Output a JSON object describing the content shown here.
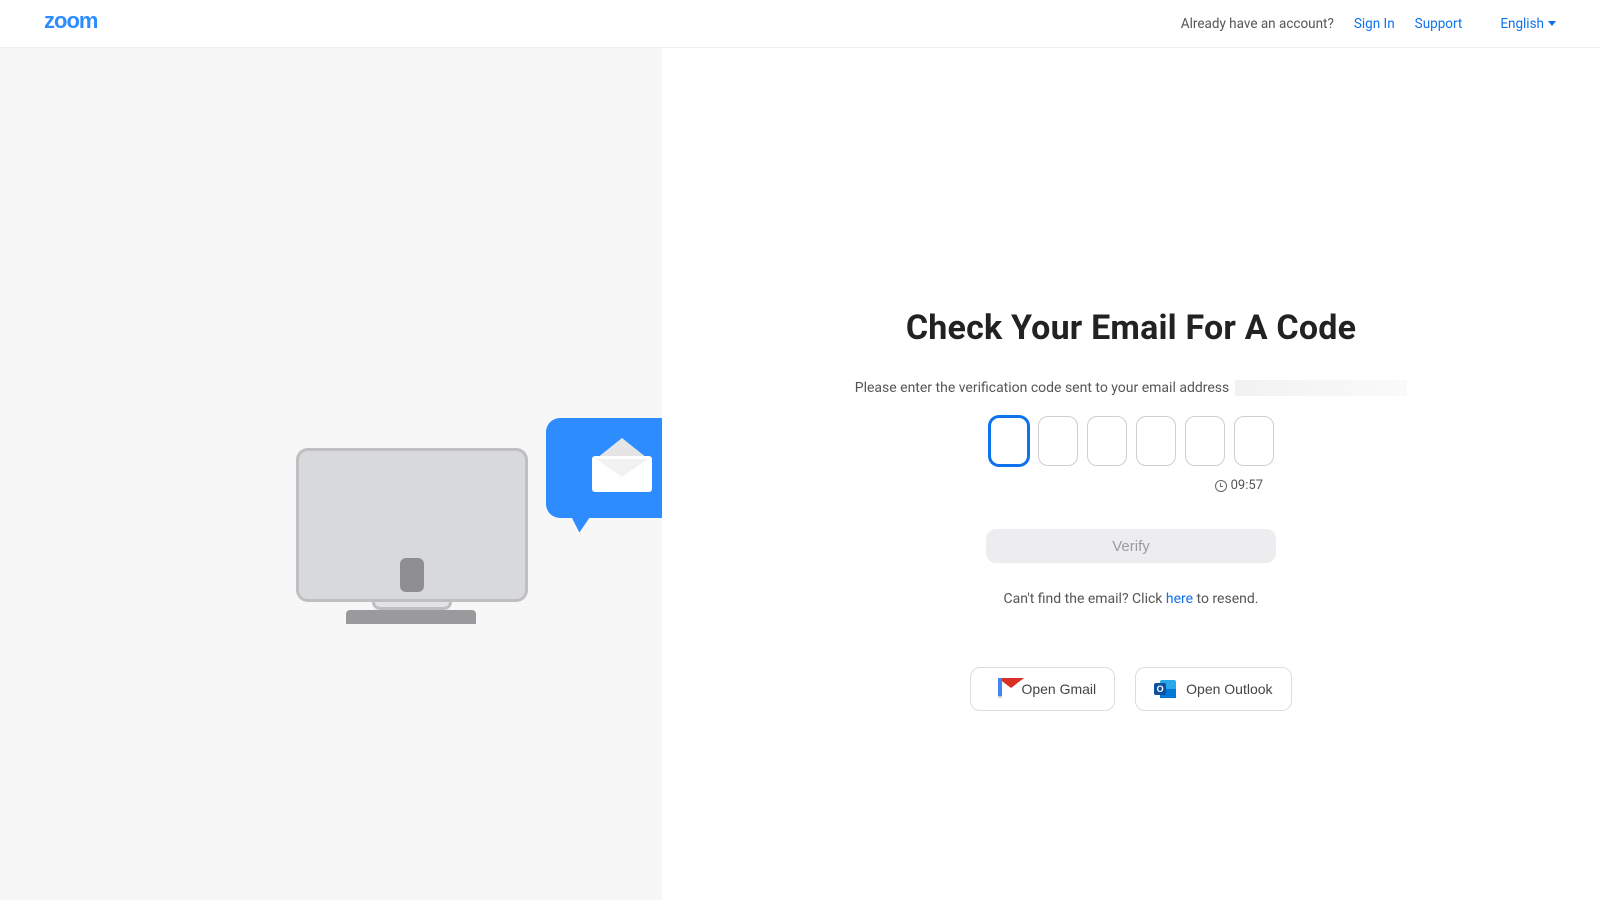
{
  "header": {
    "already_text": "Already have an account?",
    "sign_in": "Sign In",
    "support": "Support",
    "language": "English"
  },
  "main": {
    "title": "Check Your Email For A Code",
    "description": "Please enter the verification code sent to your email address",
    "timer": "09:57",
    "verify_label": "Verify",
    "resend_prefix": "Can't find the email? Click ",
    "resend_link": "here",
    "resend_suffix": " to resend.",
    "open_gmail": "Open Gmail",
    "open_outlook": "Open Outlook",
    "code_values": [
      "",
      "",
      "",
      "",
      "",
      ""
    ]
  }
}
